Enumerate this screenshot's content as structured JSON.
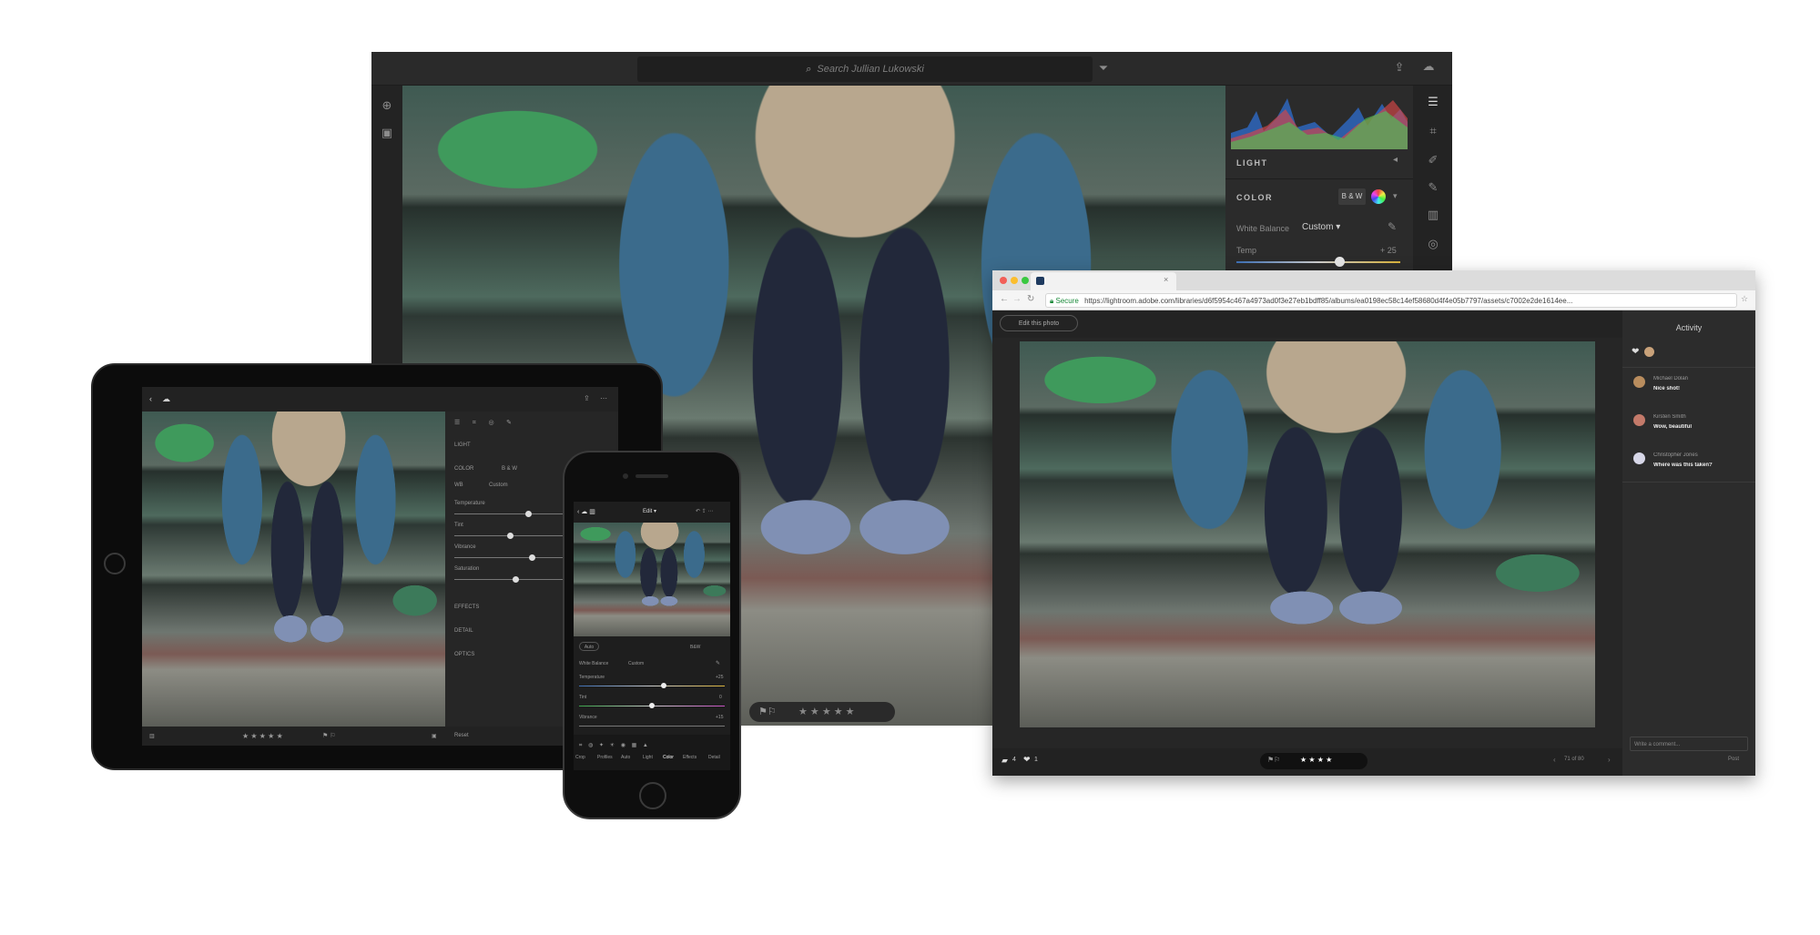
{
  "monitor": {
    "search_placeholder": "Search Jullian Lukowski",
    "panel": {
      "light_label": "LIGHT",
      "color_label": "COLOR",
      "bw_label": "B & W",
      "white_balance_label": "White Balance",
      "white_balance_value": "Custom",
      "temp_label": "Temp",
      "temp_value": "+ 25"
    },
    "bottom_stars": "★ ★ ★ ★ ★"
  },
  "tablet": {
    "panel": {
      "light": "LIGHT",
      "color": "COLOR",
      "bw": "B & W",
      "wb": "WB",
      "wb_value": "Custom",
      "temperature": "Temperature",
      "tint": "Tint",
      "vibrance": "Vibrance",
      "saturation": "Saturation",
      "effects": "EFFECTS",
      "detail": "DETAIL",
      "optics": "OPTICS",
      "reset": "Reset"
    },
    "stars": "★ ★ ★ ★ ★"
  },
  "phone": {
    "edit_label": "Edit",
    "auto_label": "Auto",
    "bw_label": "B&W",
    "white_balance_label": "White Balance",
    "white_balance_value": "Custom",
    "temperature_label": "Temperature",
    "temperature_value": "+25",
    "tint_label": "Tint",
    "tint_value": "0",
    "vibrance_label": "Vibrance",
    "vibrance_value": "+15",
    "tools": [
      "Crop",
      "Profiles",
      "Auto",
      "Light",
      "Color",
      "Effects",
      "Detail"
    ]
  },
  "browser": {
    "secure_label": "Secure",
    "url": "https://lightroom.adobe.com/libraries/d6f5954c467a4973ad0f3e27eb1bdff85/albums/ea0198ec58c14ef58680d4f4e05b7797/assets/c7002e2de1614ee...",
    "edit_button": "Edit this photo",
    "activity_title": "Activity",
    "comments": [
      {
        "name": "Michael Dolan",
        "text": "Nice shot!"
      },
      {
        "name": "Kirsten Smith",
        "text": "Wow, beautiful"
      },
      {
        "name": "Christopher Jones",
        "text": "Where was this taken?"
      }
    ],
    "comment_placeholder": "Write a comment...",
    "post_button": "Post",
    "comment_count": "4",
    "like_count": "1",
    "stars": "★ ★ ★ ★",
    "pager": "71 of 80"
  }
}
